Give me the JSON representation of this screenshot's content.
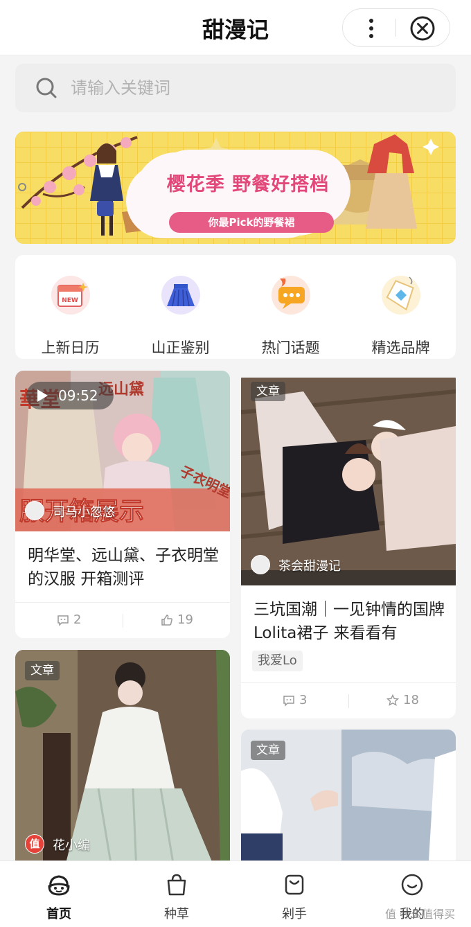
{
  "header": {
    "title": "甜漫记",
    "more_icon": "more-vertical-icon",
    "close_icon": "close-circle-icon"
  },
  "search": {
    "placeholder": "请输入关键词",
    "icon": "search-icon"
  },
  "banner": {
    "title": "樱花季 野餐好搭档",
    "subtitle": "你最Pick的野餐裙"
  },
  "categories": [
    {
      "label": "上新日历",
      "icon": "new-calendar-icon"
    },
    {
      "label": "山正鉴别",
      "icon": "skirt-icon"
    },
    {
      "label": "热门话题",
      "icon": "chat-bubble-icon"
    },
    {
      "label": "精选品牌",
      "icon": "brand-tag-icon"
    }
  ],
  "feed": {
    "card1": {
      "duration": "09:52",
      "author": "司马小忽悠",
      "title": "明华堂、远山黛、子衣明堂的汉服 开箱测评",
      "comments": "2",
      "likes": "19",
      "overlay_text": "服开箱展示",
      "sign_text_1": "華堂",
      "sign_text_2": "远山黛",
      "sign_text_3": "子衣明堂"
    },
    "card2": {
      "badge": "文章",
      "author": "茶会甜漫记",
      "title": "三坑国潮｜一见钟情的国牌Lolita裙子 来看看有",
      "tag": "我爱Lo",
      "comments": "3",
      "favorites": "18"
    },
    "card3": {
      "badge": "文章",
      "author": "花小编",
      "author_badge": "值"
    },
    "card4": {
      "badge": "文章"
    }
  },
  "tabbar": {
    "tabs": [
      {
        "label": "首页",
        "icon": "home-face-icon",
        "active": true
      },
      {
        "label": "种草",
        "icon": "shopping-bag-icon",
        "active": false
      },
      {
        "label": "剁手",
        "icon": "cart-bag-icon",
        "active": false
      },
      {
        "label": "我的",
        "icon": "smiley-icon",
        "active": false
      }
    ]
  },
  "watermark": "值 什么值得买",
  "colors": {
    "banner_bg": "#f7dd63",
    "banner_title": "#e2497a",
    "accent_red": "#e5433a"
  }
}
